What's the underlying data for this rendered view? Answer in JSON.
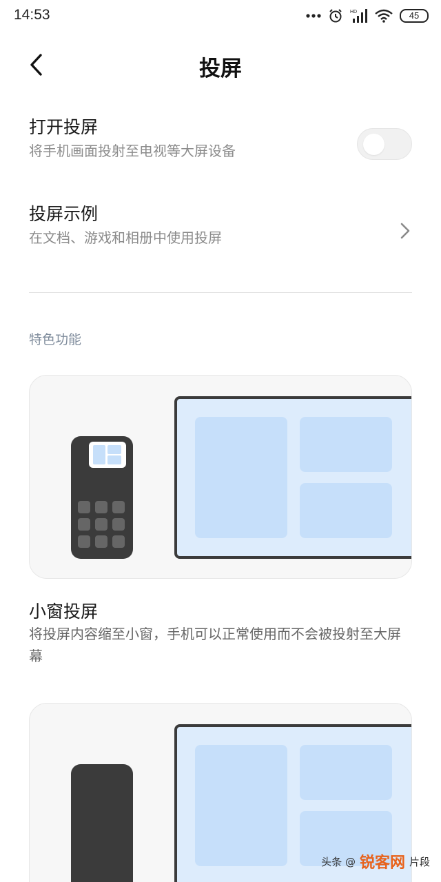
{
  "status_bar": {
    "time": "14:53",
    "battery": "45",
    "icons": [
      "more-dots-icon",
      "alarm-icon",
      "hd-signal-icon",
      "wifi-icon",
      "battery-icon"
    ]
  },
  "header": {
    "title": "投屏",
    "back_icon": "chevron-left-icon"
  },
  "settings": {
    "open_cast": {
      "title": "打开投屏",
      "subtitle": "将手机画面投射至电视等大屏设备",
      "enabled": false
    },
    "cast_examples": {
      "title": "投屏示例",
      "subtitle": "在文档、游戏和相册中使用投屏"
    }
  },
  "section": {
    "label": "特色功能"
  },
  "features": [
    {
      "title": "小窗投屏",
      "description": "将投屏内容缩至小窗，手机可以正常使用而不会被投射至大屏幕"
    }
  ],
  "watermark": {
    "prefix": "头条 @",
    "brand": "锐客网",
    "suffix": "片段"
  },
  "colors": {
    "accent_blue": "#c6dffa",
    "screen_bg": "#ddecfc",
    "device_dark": "#3b3b3b",
    "section_label": "#7f8c9c"
  }
}
